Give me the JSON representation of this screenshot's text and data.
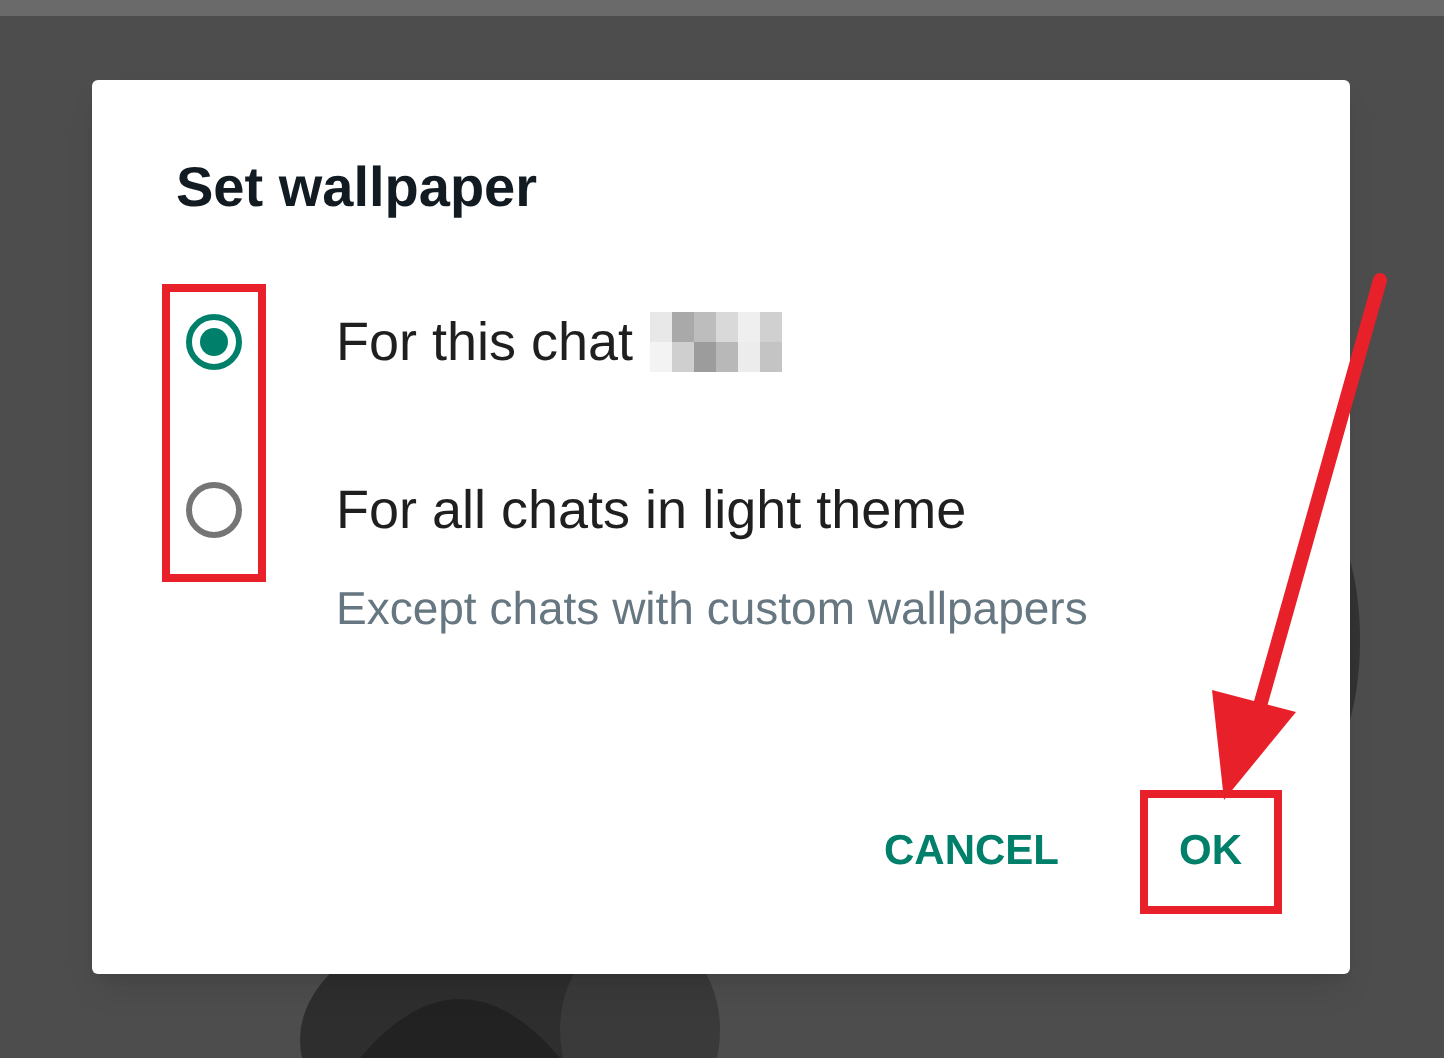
{
  "dialog": {
    "title": "Set wallpaper",
    "options": [
      {
        "label": "For this chat",
        "selected": true,
        "redacted": true
      },
      {
        "label": "For all chats in light theme",
        "selected": false,
        "note": "Except chats with custom wallpapers"
      }
    ],
    "buttons": [
      {
        "label": "CANCEL",
        "highlighted": false
      },
      {
        "label": "OK",
        "highlighted": true
      }
    ]
  }
}
